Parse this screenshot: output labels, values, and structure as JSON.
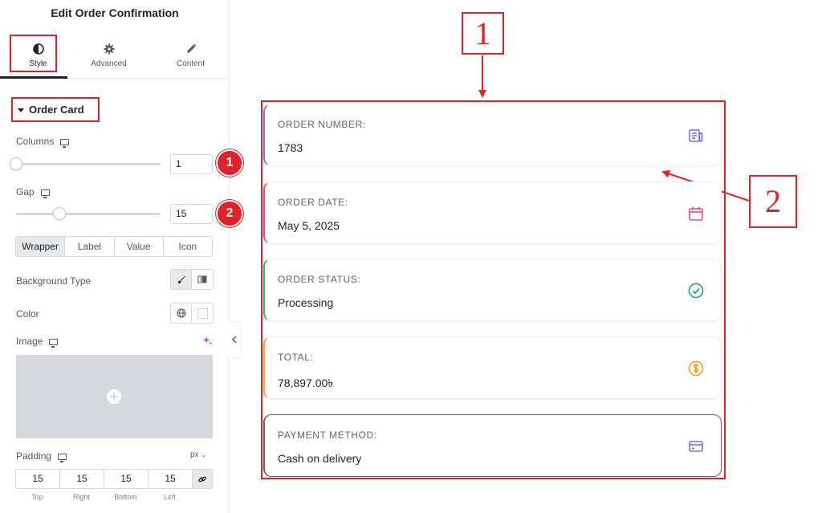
{
  "panel": {
    "title": "Edit Order Confirmation",
    "tabs": [
      {
        "label": "Style",
        "icon": "contrast-icon"
      },
      {
        "label": "Advanced",
        "icon": "gear-icon"
      },
      {
        "label": "Content",
        "icon": "pencil-icon"
      }
    ],
    "section_title": "Order Card",
    "columns": {
      "label": "Columns",
      "value": "1",
      "slider_fraction": 0.0
    },
    "gap": {
      "label": "Gap",
      "value": "15",
      "slider_fraction": 0.3
    },
    "state_tabs": [
      "Wrapper",
      "Label",
      "Value",
      "Icon"
    ],
    "background_type_label": "Background Type",
    "color_label": "Color",
    "image_label": "Image",
    "padding": {
      "label": "Padding",
      "unit": "px",
      "values": [
        "15",
        "15",
        "15",
        "15"
      ],
      "sides": [
        "Top",
        "Right",
        "Bottom",
        "Left"
      ]
    }
  },
  "callouts": {
    "one": "1",
    "two": "2"
  },
  "badges": {
    "one": "1",
    "two": "2"
  },
  "cards": [
    {
      "label": "ORDER NUMBER:",
      "value": "1783",
      "accent": "#7b6cf0",
      "icon": "receipt-icon",
      "icon_color": "#6b6fe6"
    },
    {
      "label": "ORDER DATE:",
      "value": "May 5, 2025",
      "accent": "#e04d8f",
      "icon": "calendar-icon",
      "icon_color": "#e0479a"
    },
    {
      "label": "ORDER STATUS:",
      "value": "Processing",
      "accent": "#2bb673",
      "icon": "check-circle-icon",
      "icon_color": "#1faa63"
    },
    {
      "label": "TOTAL:",
      "value": "78,897.00৳",
      "accent": "#f2a638",
      "icon": "dollar-circle-icon",
      "icon_color": "#e9a21f"
    },
    {
      "label": "PAYMENT METHOD:",
      "value": "Cash on delivery",
      "accent": "#5f6670",
      "icon": "card-icon",
      "icon_color": "#7b6cf0"
    }
  ]
}
